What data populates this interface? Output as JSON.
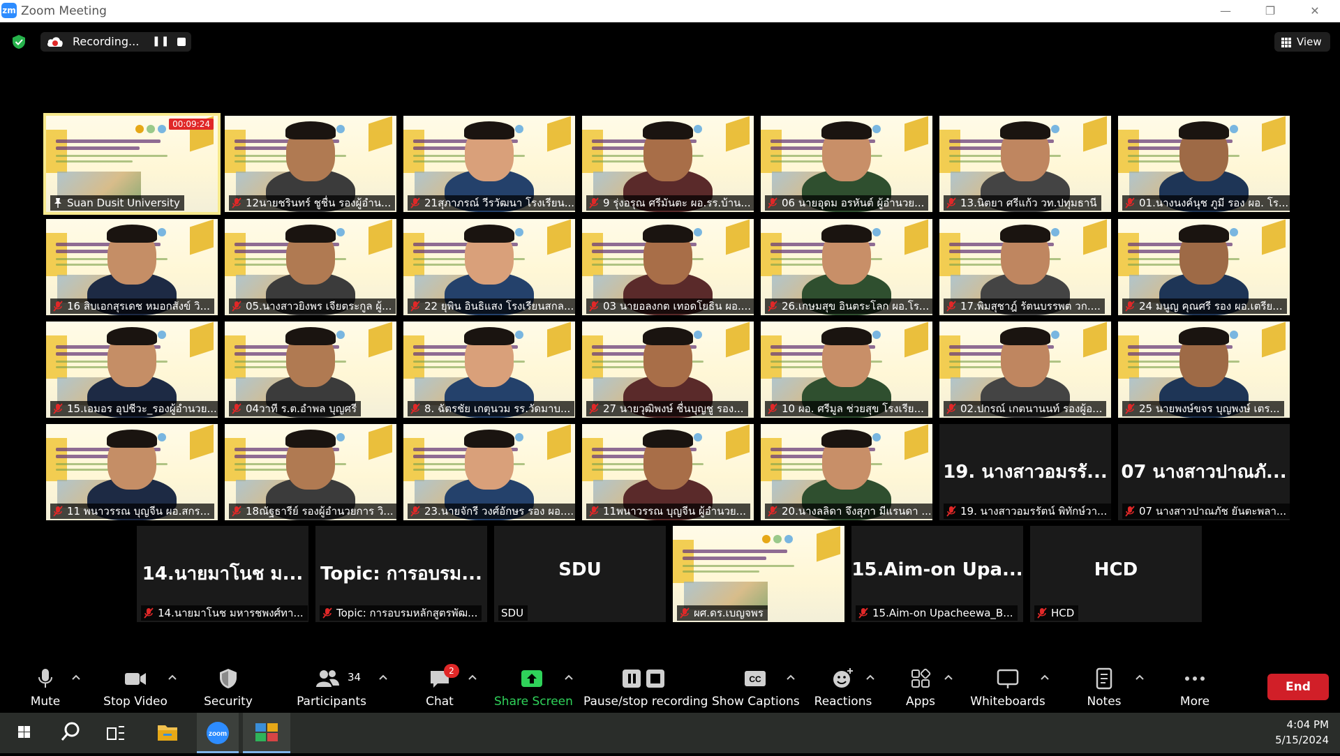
{
  "window": {
    "app_logo": "zm",
    "title": "Zoom Meeting"
  },
  "recording": {
    "label": "Recording...",
    "pause_icon": "pause-icon",
    "stop_icon": "stop-icon"
  },
  "view": {
    "label": "View"
  },
  "colors": {
    "accent_green": "#2fd35a",
    "end_red": "#d11f28",
    "active_tile": "#f7e98c",
    "timer_red": "#e02828"
  },
  "grid": {
    "timer": "00:09:24",
    "row1": [
      {
        "name": "Suan Dusit University",
        "kind": "slide"
      },
      {
        "name": "12นายชรินทร์ ชูชื่น รองผู้อำน...",
        "kind": "video"
      },
      {
        "name": "21สุภาภรณ์ วีรวัฒนา โรงเรียน...",
        "kind": "video"
      },
      {
        "name": "9 รุ่งอรุณ ศรีมันตะ ผอ.รร.บ้าน...",
        "kind": "video"
      },
      {
        "name": "06 นายอุดม อรหันต์ ผู้อำนวย...",
        "kind": "video"
      },
      {
        "name": "13.นิตยา ศรีแก้ว วท.ปทุมธานี",
        "kind": "video"
      },
      {
        "name": "01.นางนงค์นุช ภูมี รอง ผอ. โร...",
        "kind": "video"
      }
    ],
    "row2": [
      {
        "name": "16 สิบเอกสุรเดช หมอกสังข์ วิ...",
        "kind": "video"
      },
      {
        "name": "05.นางสาวยิงพร เจียตระกูล ผู้...",
        "kind": "video"
      },
      {
        "name": "22 ยุพิน อินธิแสง โรงเรียนสกล...",
        "kind": "video"
      },
      {
        "name": "03 นายอลงกต เทอดโยธิน ผอ....",
        "kind": "video"
      },
      {
        "name": "26.เกษมสุข อินตระโลก ผอ.โร...",
        "kind": "video"
      },
      {
        "name": "17.พิมสุชาฎ์ รัตนบรรพต วก....",
        "kind": "video"
      },
      {
        "name": "24 มนูญ คุณศรี รอง ผอ.เตรีย...",
        "kind": "video"
      }
    ],
    "row3": [
      {
        "name": "15.เอมอร อุปชีวะ_รองผู้อำนวย...",
        "kind": "video"
      },
      {
        "name": "04วาที ร.ต.อำพล บุญศรี",
        "kind": "video"
      },
      {
        "name": "8. ฉัตรชัย เกตุนวม รร.วัดมาบ...",
        "kind": "video"
      },
      {
        "name": "27 นายวุฒิพงษ์ ชื่นบุญชู รอง...",
        "kind": "video"
      },
      {
        "name": "10 ผอ. ศรีมูล ช่วยสุข โรงเรีย...",
        "kind": "video"
      },
      {
        "name": "02.ปกรณ์ เกตนานนท์ รองผู้อ...",
        "kind": "video"
      },
      {
        "name": "25 นายพงษ์ขจร บุญพงษ์ เตร...",
        "kind": "video"
      }
    ],
    "row4": [
      {
        "name": "11 พนาวรรณ บุญจีน ผอ.สกร...",
        "kind": "video"
      },
      {
        "name": "18ณัฐธารีย์ รองผู้อำนวยการ วิ...",
        "kind": "video"
      },
      {
        "name": "23.นายจักรี วงศ์อักษร รอง ผอ....",
        "kind": "video"
      },
      {
        "name": "11พนาวรรณ บุญจีน ผู้อำนวย...",
        "kind": "video"
      },
      {
        "name": "20.นางลลิดา จึงสุภา มีแรนดา ...",
        "kind": "video"
      },
      {
        "name": "19. นางสาวอมรรัตน์ พิทักษ์วา...",
        "kind": "text",
        "big": "19. นางสาวอมรรั..."
      },
      {
        "name": "07 นางสาวปาณภัช ยันตะพลา...",
        "kind": "text",
        "big": "07 นางสาวปาณภั..."
      }
    ],
    "row5": [
      {
        "name": "14.นายมาโนช มหารชพงศ์ทา...",
        "kind": "text",
        "big": "14.นายมาโนช ม..."
      },
      {
        "name": "Topic: การอบรมหลักสูตรพัฒ...",
        "kind": "text",
        "big": "Topic: การอบรม..."
      },
      {
        "name": "SDU",
        "kind": "text",
        "big": "SDU",
        "nomic": true
      },
      {
        "name": "ผศ.ดร.เบญจพร",
        "kind": "video"
      },
      {
        "name": "15.Aim-on Upacheewa_B...",
        "kind": "text",
        "big": "15.Aim-on  Upa..."
      },
      {
        "name": "HCD",
        "kind": "text",
        "big": "HCD"
      }
    ]
  },
  "toolbar": {
    "mute": "Mute",
    "stop_video": "Stop Video",
    "security": "Security",
    "participants": "Participants",
    "participant_count": "34",
    "chat": "Chat",
    "chat_badge": "2",
    "share_screen": "Share Screen",
    "pause_stop_recording": "Pause/stop recording",
    "show_captions": "Show Captions",
    "reactions": "Reactions",
    "apps": "Apps",
    "whiteboards": "Whiteboards",
    "notes": "Notes",
    "more": "More",
    "end": "End"
  },
  "taskbar": {
    "icons": [
      "windows-start-icon",
      "search-icon",
      "task-view-icon",
      "file-explorer-icon",
      "zoom-app-icon",
      "app-icon"
    ],
    "zoom_label": "zoom",
    "time": "4:04 PM",
    "date": "5/15/2024"
  }
}
